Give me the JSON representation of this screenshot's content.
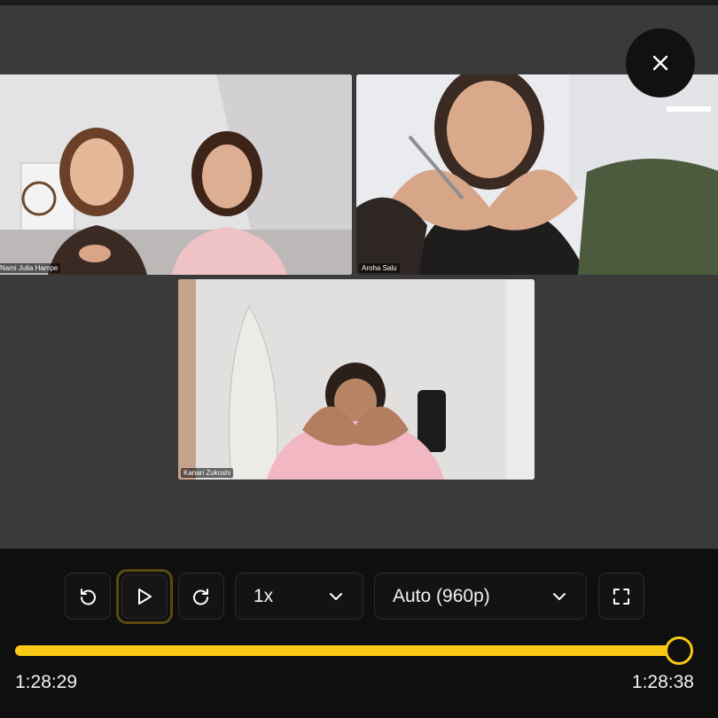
{
  "participants": [
    {
      "name": "Nami Julia Hampe"
    },
    {
      "name": "Aroha Salu"
    },
    {
      "name": "Kanari Zukoshi"
    }
  ],
  "controls": {
    "speed_label": "1x",
    "quality_label": "Auto (960p)"
  },
  "playback": {
    "current_time": "1:28:29",
    "total_time": "1:28:38",
    "progress": 0.998
  },
  "colors": {
    "accent": "#f9c814",
    "stage": "#3a3a3b",
    "controls_bg": "#0f0f10"
  },
  "icons": [
    "close-icon",
    "rewind-icon",
    "play-icon",
    "forward-icon",
    "chevron-down-icon",
    "fullscreen-icon"
  ]
}
